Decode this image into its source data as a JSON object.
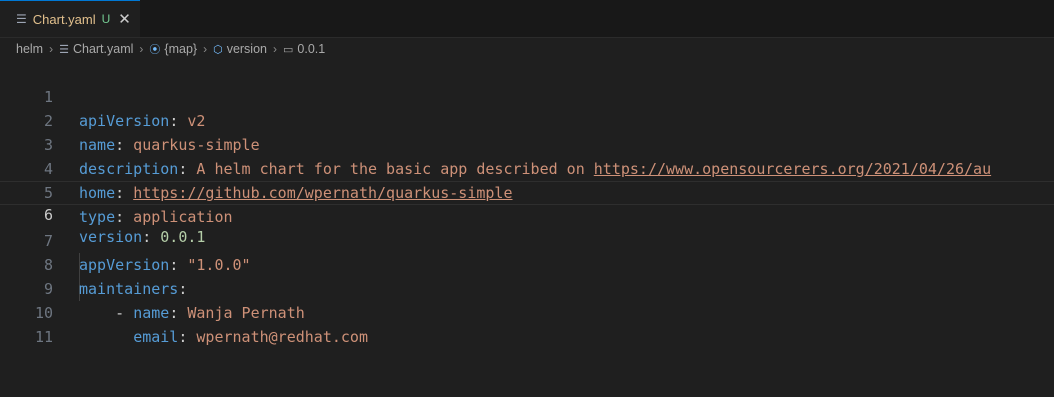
{
  "tab": {
    "icon": "lines-icon",
    "filename": "Chart.yaml",
    "status": "U",
    "close": "✕"
  },
  "breadcrumb": {
    "items": [
      "helm",
      "Chart.yaml",
      "{map}",
      "version",
      "0.0.1"
    ]
  },
  "editor": {
    "current_line": 6,
    "lines": [
      {
        "num": "1",
        "key": "apiVersion",
        "colon": ":",
        "value": " v2"
      },
      {
        "num": "2",
        "key": "name",
        "colon": ":",
        "value": " quarkus-simple"
      },
      {
        "num": "3",
        "key": "description",
        "colon": ":",
        "value": " A helm chart for the basic app described on ",
        "link": "https://www.opensourcerers.org/2021/04/26/au"
      },
      {
        "num": "4",
        "key": "home",
        "colon": ":",
        "value": " ",
        "link": "https://github.com/wpernath/quarkus-simple"
      },
      {
        "num": "5",
        "key": "type",
        "colon": ":",
        "value": " application"
      },
      {
        "num": "6",
        "key": "version",
        "colon": ":",
        "value": " 0.0.1"
      },
      {
        "num": "7",
        "key": "appVersion",
        "colon": ":",
        "value": " \"1.0.0\""
      },
      {
        "num": "8",
        "key": "maintainers",
        "colon": ":",
        "value": ""
      },
      {
        "num": "9",
        "dash": "    - ",
        "key": "name",
        "colon": ":",
        "value": " Wanja Pernath"
      },
      {
        "num": "10",
        "dash": "      ",
        "key": "email",
        "colon": ":",
        "value": " wpernath@redhat.com"
      },
      {
        "num": "11",
        "key": "",
        "colon": "",
        "value": ""
      }
    ]
  }
}
